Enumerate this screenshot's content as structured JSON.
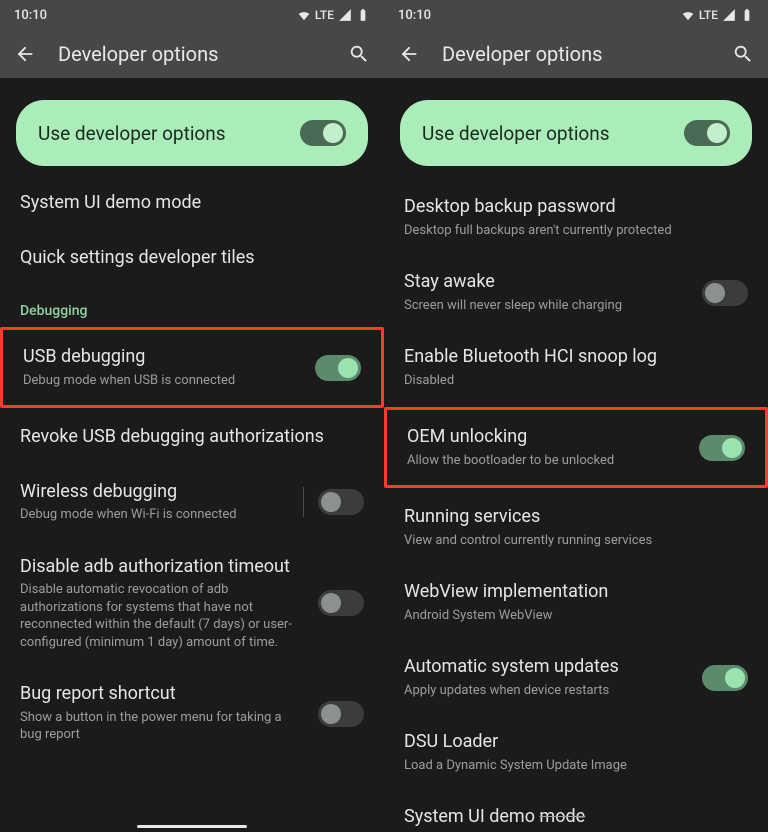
{
  "left": {
    "status_time": "10:10",
    "status_net": "LTE",
    "app_title": "Developer options",
    "hero_label": "Use developer options",
    "items": [
      {
        "title": "System UI demo mode"
      },
      {
        "title": "Quick settings developer tiles"
      }
    ],
    "section_debugging": "Debugging",
    "usb": {
      "title": "USB debugging",
      "sub": "Debug mode when USB is connected"
    },
    "revoke": {
      "title": "Revoke USB debugging authorizations"
    },
    "wireless": {
      "title": "Wireless debugging",
      "sub": "Debug mode when Wi-Fi is connected"
    },
    "adb": {
      "title": "Disable adb authorization timeout",
      "sub": "Disable automatic revocation of adb authorizations for systems that have not reconnected within the default (7 days) or user-configured (minimum 1 day) amount of time."
    },
    "bugreport": {
      "title": "Bug report shortcut",
      "sub": "Show a button in the power menu for taking a bug report"
    }
  },
  "right": {
    "status_time": "10:10",
    "status_net": "LTE",
    "app_title": "Developer options",
    "hero_label": "Use developer options",
    "desktop": {
      "title": "Desktop backup password",
      "sub": "Desktop full backups aren't currently protected"
    },
    "stayawake": {
      "title": "Stay awake",
      "sub": "Screen will never sleep while charging"
    },
    "hci": {
      "title": "Enable Bluetooth HCI snoop log",
      "sub": "Disabled"
    },
    "oem": {
      "title": "OEM unlocking",
      "sub": "Allow the bootloader to be unlocked"
    },
    "running": {
      "title": "Running services",
      "sub": "View and control currently running services"
    },
    "webview": {
      "title": "WebView implementation",
      "sub": "Android System WebView"
    },
    "autoupdate": {
      "title": "Automatic system updates",
      "sub": "Apply updates when device restarts"
    },
    "dsu": {
      "title": "DSU Loader",
      "sub": "Load a Dynamic System Update Image"
    },
    "demo": {
      "title_a": "System UI demo ",
      "title_b": "mode"
    }
  }
}
